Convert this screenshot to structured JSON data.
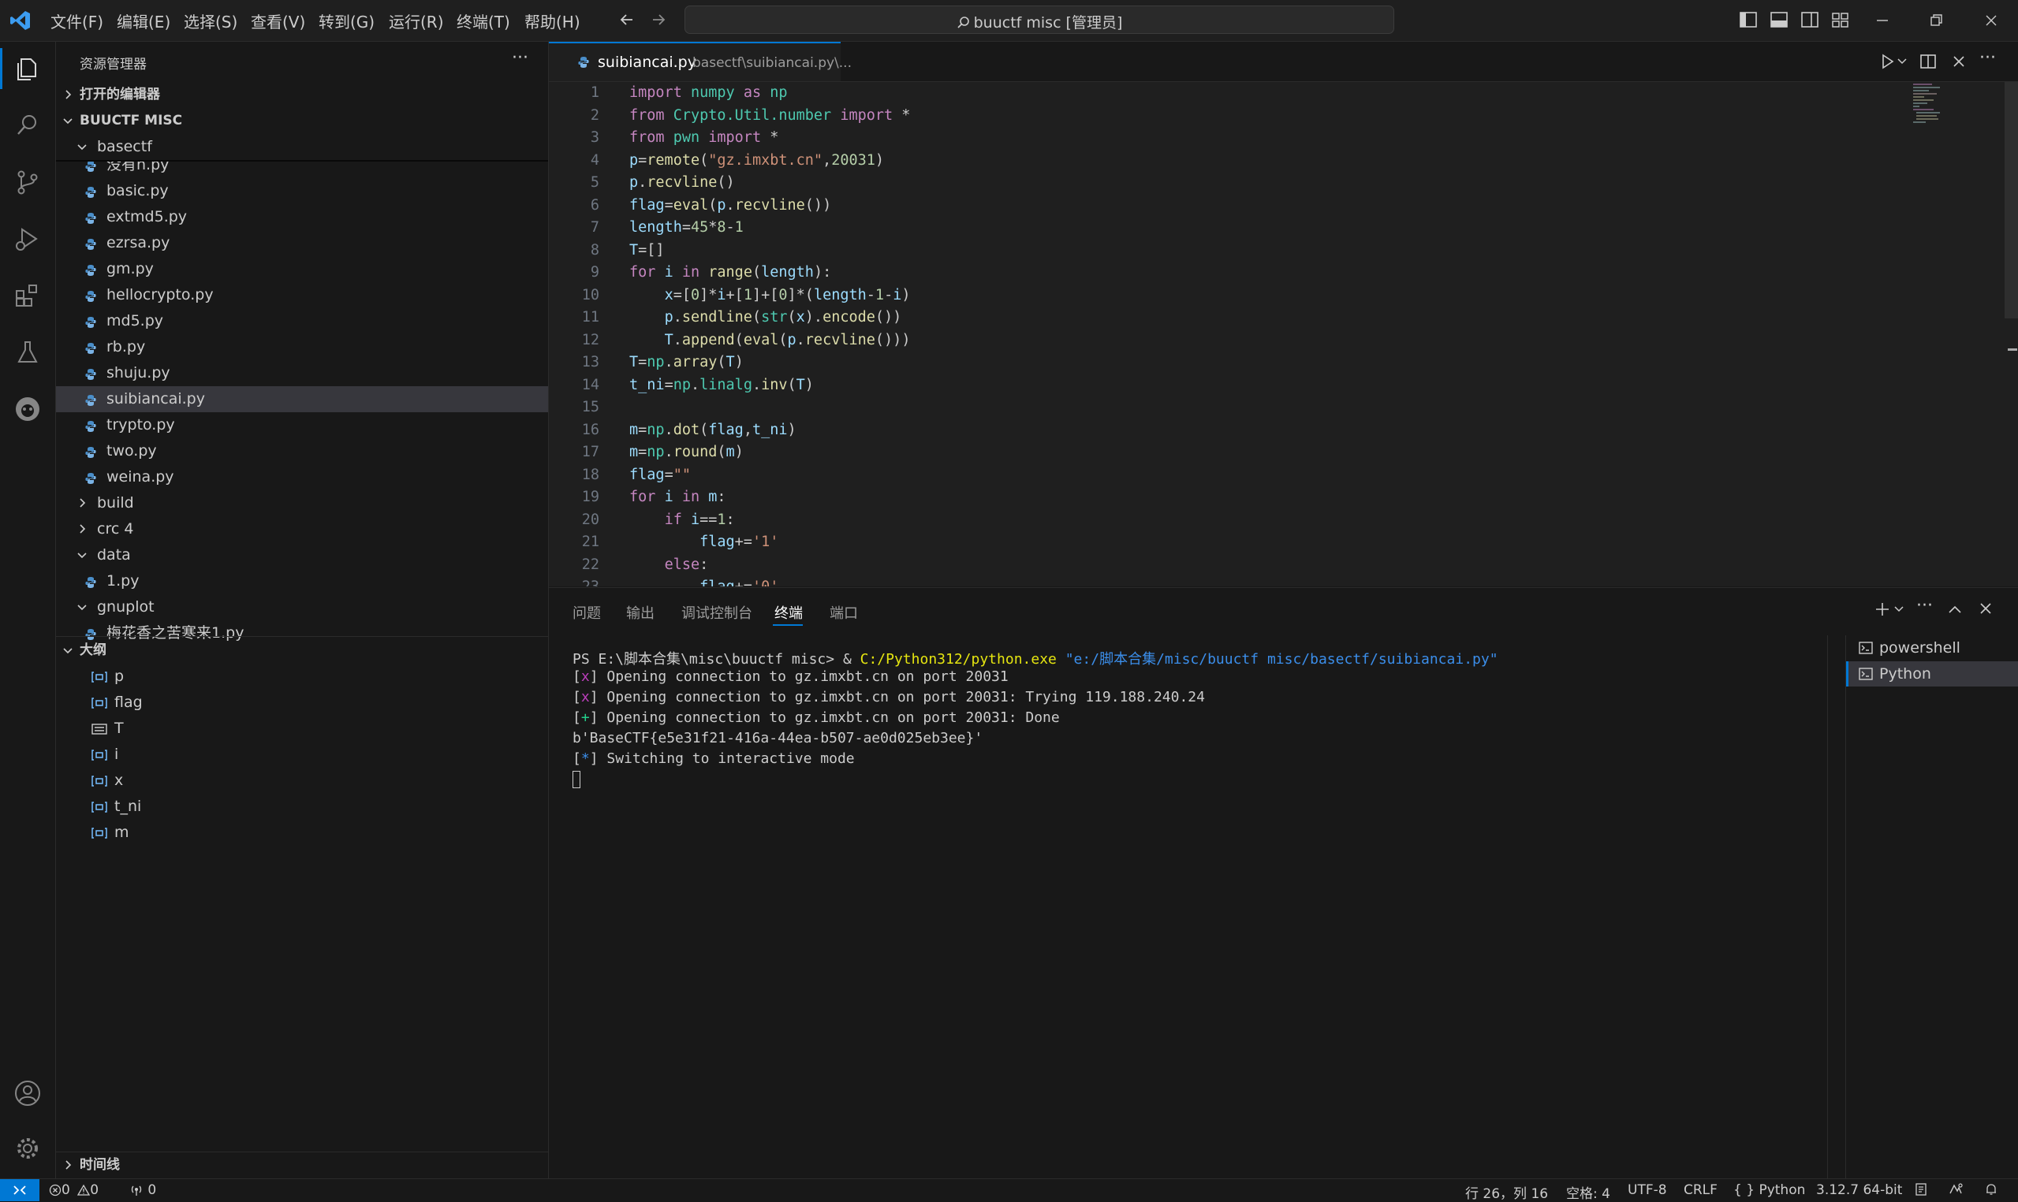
{
  "titlebar": {
    "menu": [
      "文件(F)",
      "编辑(E)",
      "选择(S)",
      "查看(V)",
      "转到(G)",
      "运行(R)",
      "终端(T)",
      "帮助(H)"
    ],
    "search_text": "buuctf misc [管理员]"
  },
  "sidebar": {
    "title": "资源管理器",
    "open_editors": "打开的编辑器",
    "workspace": "BUUCTF MISC",
    "folder_basectf": "basectf",
    "partial_top": "没有n.py",
    "files": [
      "basic.py",
      "extmd5.py",
      "ezrsa.py",
      "gm.py",
      "hellocrypto.py",
      "md5.py",
      "rb.py",
      "shuju.py",
      "suibiancai.py",
      "trypto.py",
      "two.py",
      "weina.py"
    ],
    "folders_after": [
      "build",
      "crc 4",
      "data"
    ],
    "data_file": "1.py",
    "gnuplot": "gnuplot",
    "partial_bottom": "梅花香之苦寒来1.py",
    "outline_title": "大纲",
    "outline": [
      {
        "name": "p",
        "kind": "variable"
      },
      {
        "name": "flag",
        "kind": "variable"
      },
      {
        "name": "T",
        "kind": "list"
      },
      {
        "name": "i",
        "kind": "variable"
      },
      {
        "name": "x",
        "kind": "variable"
      },
      {
        "name": "t_ni",
        "kind": "variable"
      },
      {
        "name": "m",
        "kind": "variable"
      }
    ],
    "timeline": "时间线"
  },
  "editor": {
    "tab_name": "suibiancai.py",
    "tab_path": "basectf\\suibiancai.py\\...",
    "line_numbers": [
      "1",
      "2",
      "3",
      "4",
      "5",
      "6",
      "7",
      "8",
      "9",
      "10",
      "11",
      "12",
      "13",
      "14",
      "15",
      "16",
      "17",
      "18",
      "19",
      "20",
      "21",
      "22",
      "23"
    ]
  },
  "panel": {
    "tabs": [
      "问题",
      "输出",
      "调试控制台",
      "终端",
      "端口"
    ],
    "active_tab": "终端",
    "terminal": {
      "prompt": "PS E:\\脚本合集\\misc\\buuctf misc> ",
      "cmd_amp": "& ",
      "cmd_exe": "C:/Python312/python.exe",
      "cmd_arg": "\"e:/脚本合集/misc/buuctf misc/basectf/suibiancai.py\"",
      "lines": [
        {
          "sym": "x",
          "text": "Opening connection to gz.imxbt.cn on port 20031"
        },
        {
          "sym": "x",
          "text": "Opening connection to gz.imxbt.cn on port 20031: Trying 119.188.240.24"
        },
        {
          "sym": "+",
          "text": "Opening connection to gz.imxbt.cn on port 20031: Done"
        }
      ],
      "flag_line": "b'BaseCTF{e5e31f21-416a-44ea-b507-ae0d025eb3ee}'",
      "interactive": "Switching to interactive mode"
    },
    "terminal_list": [
      "powershell",
      "Python"
    ]
  },
  "statusbar": {
    "errors": "0",
    "warnings": "0",
    "ports": "0",
    "cursor": "行 26，列 16",
    "spaces": "空格: 4",
    "encoding": "UTF-8",
    "eol": "CRLF",
    "language": "Python",
    "interpreter": "3.12.7 64-bit"
  },
  "colors": {
    "accent": "#0078d4",
    "background": "#181818",
    "editor_bg": "#1f1f1f"
  }
}
